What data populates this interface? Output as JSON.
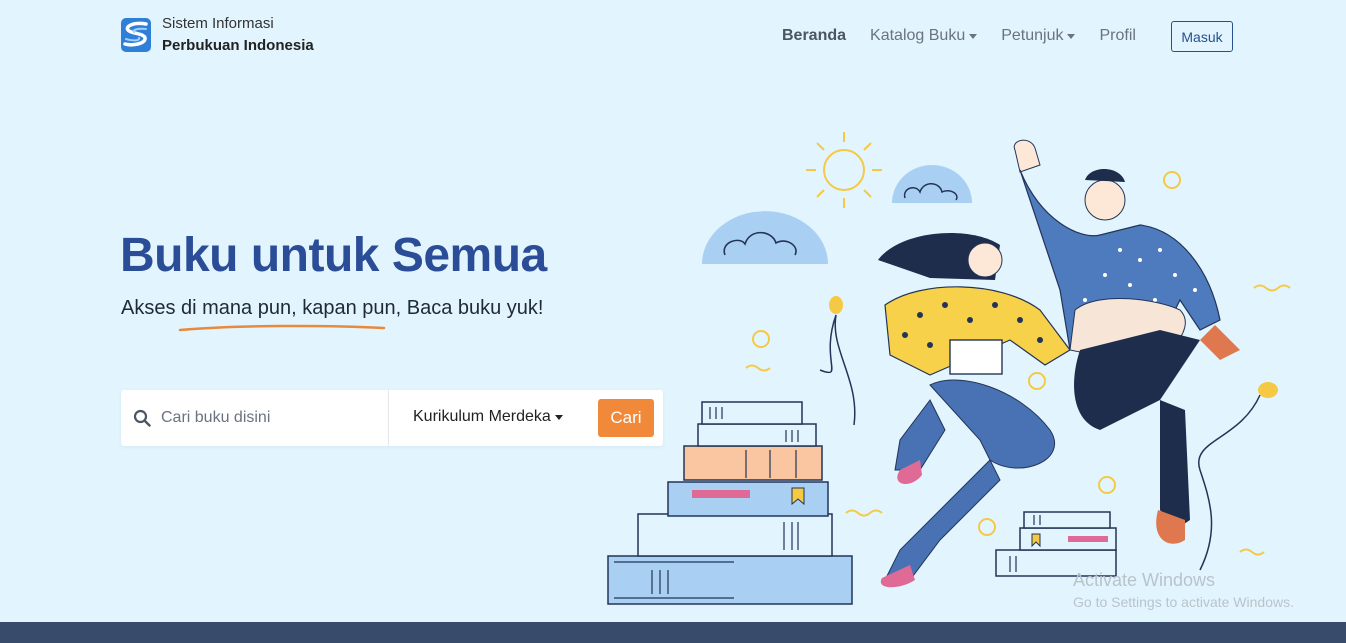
{
  "brand": {
    "line1": "Sistem Informasi",
    "line2": "Perbukuan Indonesia",
    "logo_icon": "stacked-s-logo-icon",
    "colors": {
      "primary": "#2b4c96",
      "accent": "#f08a3a",
      "background": "#e2f5fe",
      "footer": "#394b6a"
    }
  },
  "nav": {
    "items": [
      {
        "label": "Beranda",
        "active": true,
        "dropdown": false
      },
      {
        "label": "Katalog Buku",
        "active": false,
        "dropdown": true
      },
      {
        "label": "Petunjuk",
        "active": false,
        "dropdown": true
      },
      {
        "label": "Profil",
        "active": false,
        "dropdown": false
      }
    ],
    "login_label": "Masuk"
  },
  "hero": {
    "title": "Buku untuk Semua",
    "subtitle": "Akses di mana pun, kapan pun, Baca buku yuk!"
  },
  "search": {
    "icon": "search-icon",
    "placeholder": "Cari buku disini",
    "value": "",
    "curriculum_selected": "Kurikulum Merdeka",
    "submit_label": "Cari"
  },
  "watermark": {
    "title": "Activate Windows",
    "subtitle": "Go to Settings to activate Windows."
  }
}
